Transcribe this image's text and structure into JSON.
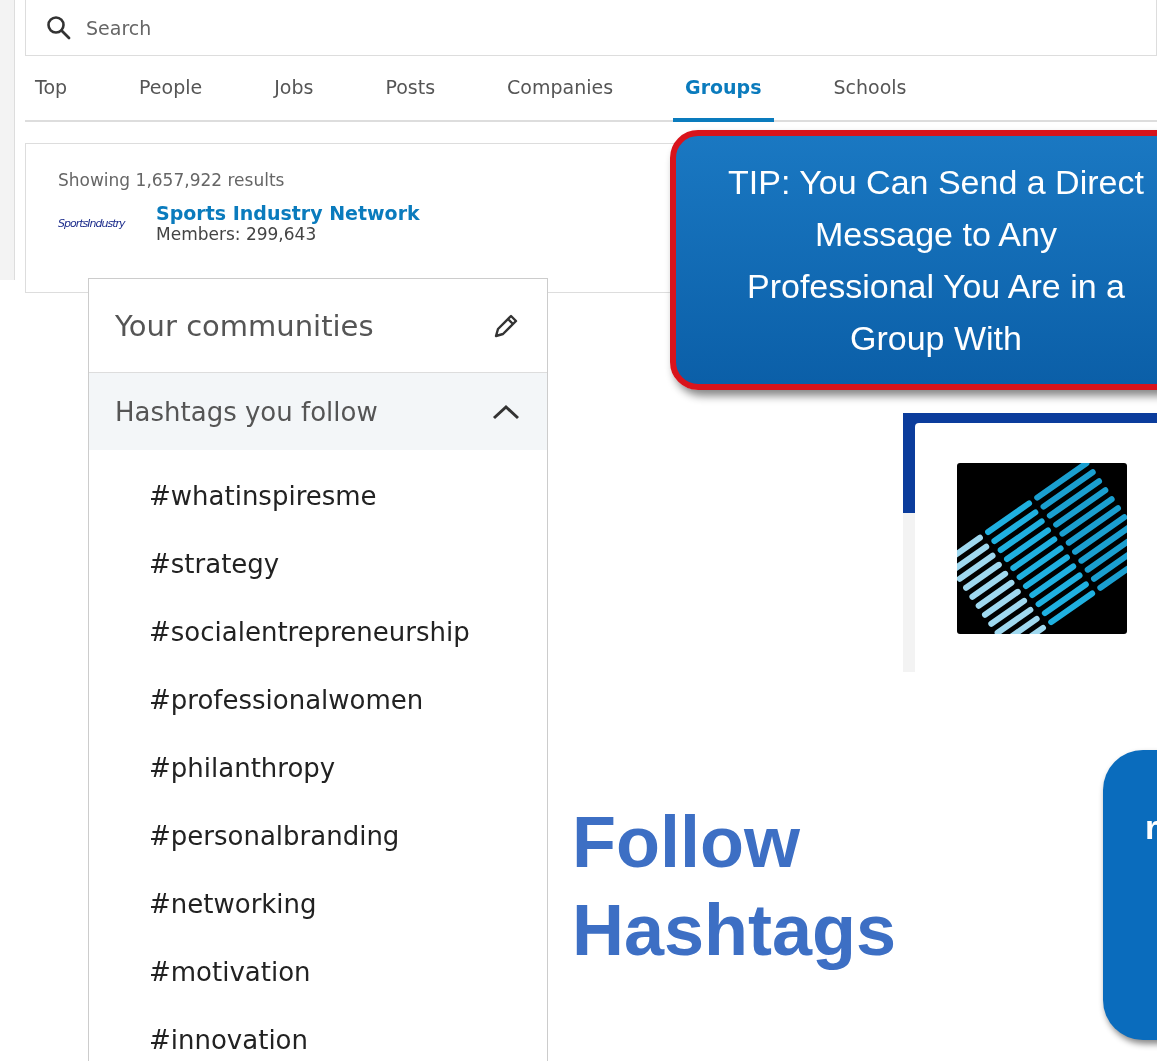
{
  "search": {
    "placeholder": "Search"
  },
  "tabs": [
    {
      "label": "Top",
      "selected": false
    },
    {
      "label": "People",
      "selected": false
    },
    {
      "label": "Jobs",
      "selected": false
    },
    {
      "label": "Posts",
      "selected": false
    },
    {
      "label": "Companies",
      "selected": false
    },
    {
      "label": "Groups",
      "selected": true
    },
    {
      "label": "Schools",
      "selected": false
    }
  ],
  "results": {
    "count": "Showing 1,657,922 results",
    "items": [
      {
        "logo": "SportsIndustry",
        "name": "Sports Industry Network",
        "members": "Members: 299,643"
      }
    ]
  },
  "communities": {
    "title": "Your communities",
    "section": {
      "title": "Hashtags you follow",
      "expanded": true
    },
    "hashtags": [
      "#whatinspiresme",
      "#strategy",
      "#socialentrepreneurship",
      "#professionalwomen",
      "#philanthropy",
      "#personalbranding",
      "#networking",
      "#motivation",
      "#innovation"
    ]
  },
  "tip": "TIP: You Can Send a Direct Message to Any Professional You Are in a Group With",
  "heading": "Follow Hashtags",
  "side_box": "r"
}
